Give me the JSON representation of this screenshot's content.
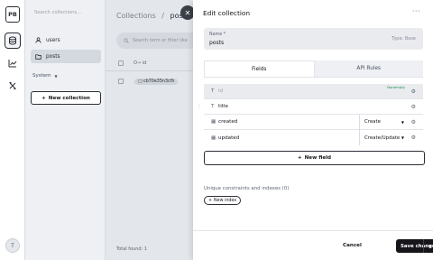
{
  "sidebar": {
    "search_placeholder": "Search collections...",
    "items": [
      {
        "label": "users",
        "icon": "users-icon"
      },
      {
        "label": "posts",
        "icon": "folder-icon"
      }
    ],
    "section_label": "System",
    "new_collection_label": "New collection"
  },
  "main": {
    "breadcrumb_root": "Collections",
    "breadcrumb_sep": "/",
    "breadcrumb_current": "posts",
    "search_placeholder": "Search term or filter like",
    "column_id": "id",
    "row_id": "cb70e35n3cfh",
    "total_label": "Total found: 1"
  },
  "panel": {
    "title": "Edit collection",
    "more": "···",
    "name_label": "Name *",
    "name_value": "posts",
    "type_label": "Type: Base",
    "tabs": [
      "Fields",
      "API Rules"
    ],
    "fields": [
      {
        "name": "id",
        "icon": "T",
        "badge": "Nonempty",
        "select": ""
      },
      {
        "name": "title",
        "icon": "T",
        "badge": "",
        "select": ""
      },
      {
        "name": "created",
        "icon": "calendar-icon",
        "badge": "",
        "select": "Create"
      },
      {
        "name": "updated",
        "icon": "calendar-icon",
        "badge": "",
        "select": "Create/Update"
      }
    ],
    "new_field_label": "New field",
    "unique_label": "Unique constraints and indexes (0)",
    "new_index_label": "New index",
    "cancel_label": "Cancel",
    "save_label": "Save changes"
  },
  "colors": {
    "accent": "#16161a",
    "success": "#1a8f4c",
    "muted": "#e9ebee"
  }
}
